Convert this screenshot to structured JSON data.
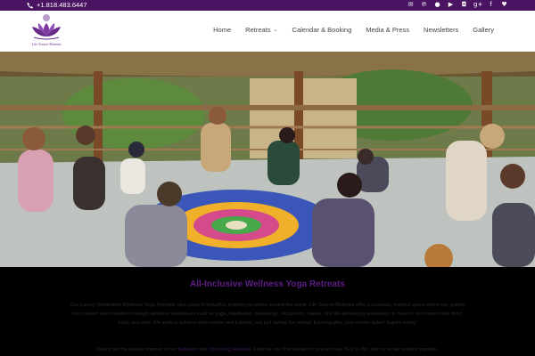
{
  "topbar": {
    "phone": "+1.818.483.6447",
    "social_icons": [
      "email-icon",
      "pinterest-icon",
      "flickr-icon",
      "youtube-icon",
      "instagram-icon",
      "google-plus-icon",
      "facebook-icon",
      "twitter-icon"
    ],
    "background": "#4b1462"
  },
  "header": {
    "logo_text": "Life Source Retreats",
    "nav": [
      {
        "label": "Home"
      },
      {
        "label": "Retreats",
        "has_dropdown": true
      },
      {
        "label": "Calendar & Booking"
      },
      {
        "label": "Media & Press"
      },
      {
        "label": "Newsletters"
      },
      {
        "label": "Gallery"
      }
    ]
  },
  "content": {
    "headline": "All-Inclusive Wellness Yoga Retreats",
    "paragraph": "Our Luxury Destination Wellness Yoga Retreats take place in beautiful, inspiring locations around the world. Life Source Retreats offer a luxurious, tranquil space where our guests can connect and transform through wellness techniques such as yoga, meditation, cleansings, excursions, nature, and life-enhancing workshops to nourish and expand the mind, body, and soul. We seek to achieve inner peace and balance, not just during the retreat, but long after your suntan fades! Inquire today!",
    "paragraph2_prefix": "Check out the various themes of our",
    "link1": "Retreats",
    "paragraph2_mid": "and",
    "link2": "Upcoming Retreats",
    "paragraph2_suffix": ". Find the one that speaks to you and say YES to life! Join us as we explore together."
  },
  "colors": {
    "brand_purple": "#4b1462",
    "headline_purple": "#5e1c86"
  }
}
